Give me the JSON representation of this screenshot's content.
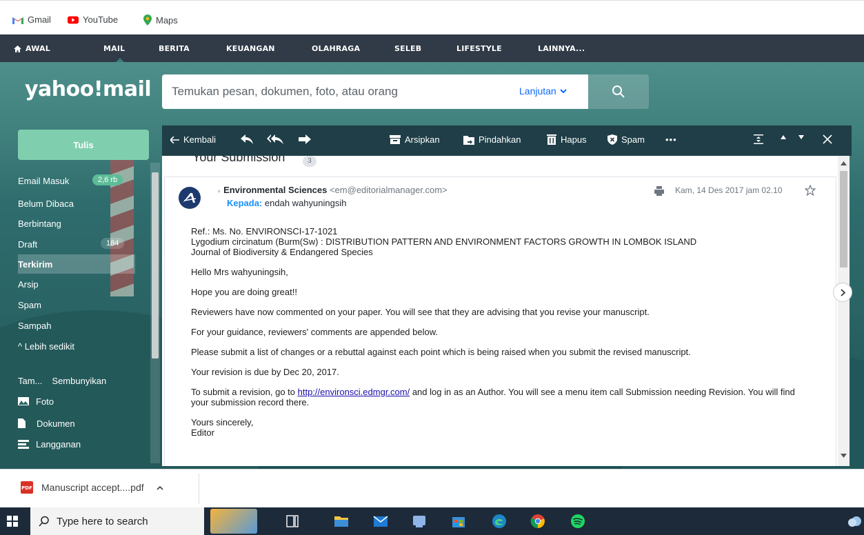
{
  "bookmarks": [
    {
      "label": "Gmail",
      "icon": "gmail-icon"
    },
    {
      "label": "YouTube",
      "icon": "youtube-icon"
    },
    {
      "label": "Maps",
      "icon": "maps-icon"
    }
  ],
  "nav": {
    "items": [
      "AWAL",
      "MAIL",
      "BERITA",
      "KEUANGAN",
      "OLAHRAGA",
      "SELEB",
      "LIFESTYLE",
      "LAINNYA..."
    ],
    "active": "MAIL"
  },
  "header": {
    "logo": "yahoo!mail",
    "search_placeholder": "Temukan pesan, dokumen, foto, atau orang",
    "advanced_label": "Lanjutan"
  },
  "sidebar": {
    "compose_label": "Tulis",
    "items": [
      {
        "label": "Email Masuk",
        "badge": "2,6 rb"
      },
      {
        "label": "Belum Dibaca"
      },
      {
        "label": "Berbintang"
      },
      {
        "label": "Draft",
        "badge": "184"
      },
      {
        "label": "Terkirim",
        "active": true
      },
      {
        "label": "Arsip"
      },
      {
        "label": "Spam"
      },
      {
        "label": "Sampah"
      },
      {
        "label": "^ Lebih sedikit"
      }
    ],
    "views_header": "Tam...",
    "hide_label": "Sembunyikan",
    "views": [
      {
        "label": "Foto",
        "icon": "photo-icon"
      },
      {
        "label": "Dokumen",
        "icon": "document-icon"
      },
      {
        "label": "Langganan",
        "icon": "subscription-icon"
      }
    ]
  },
  "toolbar": {
    "back_label": "Kembali",
    "archive_label": "Arsipkan",
    "move_label": "Pindahkan",
    "delete_label": "Hapus",
    "spam_label": "Spam",
    "more_label": "•••"
  },
  "conversation": {
    "title": "Your Submission",
    "count": "3"
  },
  "message": {
    "sender_name": "Environmental Sciences",
    "sender_email": "<em@editorialmanager.com>",
    "to_label": "Kepada:",
    "to_name": "endah wahyuningsih",
    "date": "Kam, 14 Des 2017 jam 02.10",
    "ref_line": "Ref.:  Ms. No. ENVIRONSCI-17-1021",
    "title_line": "Lygodium circinatum (Burm(Sw) : DISTRIBUTION PATTERN AND ENVIRONMENT FACTORS GROWTH IN LOMBOK ISLAND",
    "journal_line": "Journal of Biodiversity & Endangered Species",
    "greeting": "Hello Mrs wahyuningsih,",
    "p1": "Hope you are doing great!!",
    "p2": "Reviewers have now commented on your paper. You will see that they are advising that you revise your manuscript.",
    "p3": "For your guidance, reviewers' comments are appended below.",
    "p4": "Please submit a list of changes or a rebuttal against each point which is being raised when you submit the revised manuscript.",
    "p5": "Your revision is due by Dec 20, 2017.",
    "p6_before": "To submit a revision, go to ",
    "p6_link": "http://environsci.edmgr.com/",
    "p6_after": " and log in as an Author.  You will see a menu item call Submission needing Revision.  You will find your submission record there.",
    "closing": "Yours sincerely,",
    "signature": "Editor"
  },
  "download": {
    "filename": "Manuscript accept....pdf",
    "file_badge": "PDF"
  },
  "taskbar": {
    "search_placeholder": "Type here to search"
  },
  "colors": {
    "nav_bg": "#313a47",
    "compose": "#7fcfaf",
    "toolbar_bg": "#1f3e48",
    "link": "#188fff"
  }
}
